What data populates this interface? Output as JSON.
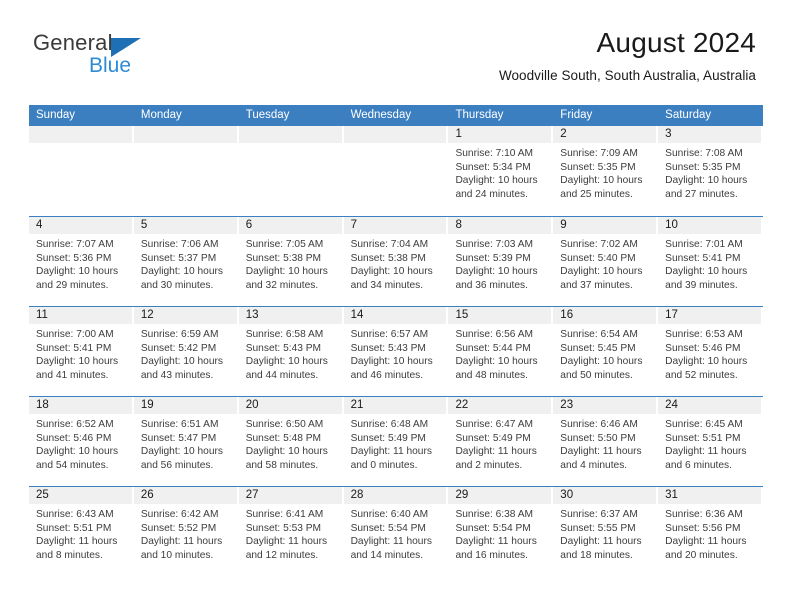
{
  "brand": {
    "name_part1": "General",
    "name_part2": "Blue",
    "logo_icon": "triangle-flag-icon",
    "color_primary": "#1f6fb5",
    "color_secondary": "#2e8bd6"
  },
  "header": {
    "title": "August 2024",
    "location": "Woodville South, South Australia, Australia"
  },
  "theme": {
    "header_row_bg": "#3c7fc1",
    "day_band_bg": "#f0f0f0",
    "divider": "#3c7fc1",
    "text": "#1a1a1a"
  },
  "weekdays": [
    "Sunday",
    "Monday",
    "Tuesday",
    "Wednesday",
    "Thursday",
    "Friday",
    "Saturday"
  ],
  "weeks": [
    [
      {
        "day": "",
        "blank": true
      },
      {
        "day": "",
        "blank": true
      },
      {
        "day": "",
        "blank": true
      },
      {
        "day": "",
        "blank": true
      },
      {
        "day": "1",
        "sunrise": "Sunrise: 7:10 AM",
        "sunset": "Sunset: 5:34 PM",
        "daylight1": "Daylight: 10 hours",
        "daylight2": "and 24 minutes."
      },
      {
        "day": "2",
        "sunrise": "Sunrise: 7:09 AM",
        "sunset": "Sunset: 5:35 PM",
        "daylight1": "Daylight: 10 hours",
        "daylight2": "and 25 minutes."
      },
      {
        "day": "3",
        "sunrise": "Sunrise: 7:08 AM",
        "sunset": "Sunset: 5:35 PM",
        "daylight1": "Daylight: 10 hours",
        "daylight2": "and 27 minutes."
      }
    ],
    [
      {
        "day": "4",
        "sunrise": "Sunrise: 7:07 AM",
        "sunset": "Sunset: 5:36 PM",
        "daylight1": "Daylight: 10 hours",
        "daylight2": "and 29 minutes."
      },
      {
        "day": "5",
        "sunrise": "Sunrise: 7:06 AM",
        "sunset": "Sunset: 5:37 PM",
        "daylight1": "Daylight: 10 hours",
        "daylight2": "and 30 minutes."
      },
      {
        "day": "6",
        "sunrise": "Sunrise: 7:05 AM",
        "sunset": "Sunset: 5:38 PM",
        "daylight1": "Daylight: 10 hours",
        "daylight2": "and 32 minutes."
      },
      {
        "day": "7",
        "sunrise": "Sunrise: 7:04 AM",
        "sunset": "Sunset: 5:38 PM",
        "daylight1": "Daylight: 10 hours",
        "daylight2": "and 34 minutes."
      },
      {
        "day": "8",
        "sunrise": "Sunrise: 7:03 AM",
        "sunset": "Sunset: 5:39 PM",
        "daylight1": "Daylight: 10 hours",
        "daylight2": "and 36 minutes."
      },
      {
        "day": "9",
        "sunrise": "Sunrise: 7:02 AM",
        "sunset": "Sunset: 5:40 PM",
        "daylight1": "Daylight: 10 hours",
        "daylight2": "and 37 minutes."
      },
      {
        "day": "10",
        "sunrise": "Sunrise: 7:01 AM",
        "sunset": "Sunset: 5:41 PM",
        "daylight1": "Daylight: 10 hours",
        "daylight2": "and 39 minutes."
      }
    ],
    [
      {
        "day": "11",
        "sunrise": "Sunrise: 7:00 AM",
        "sunset": "Sunset: 5:41 PM",
        "daylight1": "Daylight: 10 hours",
        "daylight2": "and 41 minutes."
      },
      {
        "day": "12",
        "sunrise": "Sunrise: 6:59 AM",
        "sunset": "Sunset: 5:42 PM",
        "daylight1": "Daylight: 10 hours",
        "daylight2": "and 43 minutes."
      },
      {
        "day": "13",
        "sunrise": "Sunrise: 6:58 AM",
        "sunset": "Sunset: 5:43 PM",
        "daylight1": "Daylight: 10 hours",
        "daylight2": "and 44 minutes."
      },
      {
        "day": "14",
        "sunrise": "Sunrise: 6:57 AM",
        "sunset": "Sunset: 5:43 PM",
        "daylight1": "Daylight: 10 hours",
        "daylight2": "and 46 minutes."
      },
      {
        "day": "15",
        "sunrise": "Sunrise: 6:56 AM",
        "sunset": "Sunset: 5:44 PM",
        "daylight1": "Daylight: 10 hours",
        "daylight2": "and 48 minutes."
      },
      {
        "day": "16",
        "sunrise": "Sunrise: 6:54 AM",
        "sunset": "Sunset: 5:45 PM",
        "daylight1": "Daylight: 10 hours",
        "daylight2": "and 50 minutes."
      },
      {
        "day": "17",
        "sunrise": "Sunrise: 6:53 AM",
        "sunset": "Sunset: 5:46 PM",
        "daylight1": "Daylight: 10 hours",
        "daylight2": "and 52 minutes."
      }
    ],
    [
      {
        "day": "18",
        "sunrise": "Sunrise: 6:52 AM",
        "sunset": "Sunset: 5:46 PM",
        "daylight1": "Daylight: 10 hours",
        "daylight2": "and 54 minutes."
      },
      {
        "day": "19",
        "sunrise": "Sunrise: 6:51 AM",
        "sunset": "Sunset: 5:47 PM",
        "daylight1": "Daylight: 10 hours",
        "daylight2": "and 56 minutes."
      },
      {
        "day": "20",
        "sunrise": "Sunrise: 6:50 AM",
        "sunset": "Sunset: 5:48 PM",
        "daylight1": "Daylight: 10 hours",
        "daylight2": "and 58 minutes."
      },
      {
        "day": "21",
        "sunrise": "Sunrise: 6:48 AM",
        "sunset": "Sunset: 5:49 PM",
        "daylight1": "Daylight: 11 hours",
        "daylight2": "and 0 minutes."
      },
      {
        "day": "22",
        "sunrise": "Sunrise: 6:47 AM",
        "sunset": "Sunset: 5:49 PM",
        "daylight1": "Daylight: 11 hours",
        "daylight2": "and 2 minutes."
      },
      {
        "day": "23",
        "sunrise": "Sunrise: 6:46 AM",
        "sunset": "Sunset: 5:50 PM",
        "daylight1": "Daylight: 11 hours",
        "daylight2": "and 4 minutes."
      },
      {
        "day": "24",
        "sunrise": "Sunrise: 6:45 AM",
        "sunset": "Sunset: 5:51 PM",
        "daylight1": "Daylight: 11 hours",
        "daylight2": "and 6 minutes."
      }
    ],
    [
      {
        "day": "25",
        "sunrise": "Sunrise: 6:43 AM",
        "sunset": "Sunset: 5:51 PM",
        "daylight1": "Daylight: 11 hours",
        "daylight2": "and 8 minutes."
      },
      {
        "day": "26",
        "sunrise": "Sunrise: 6:42 AM",
        "sunset": "Sunset: 5:52 PM",
        "daylight1": "Daylight: 11 hours",
        "daylight2": "and 10 minutes."
      },
      {
        "day": "27",
        "sunrise": "Sunrise: 6:41 AM",
        "sunset": "Sunset: 5:53 PM",
        "daylight1": "Daylight: 11 hours",
        "daylight2": "and 12 minutes."
      },
      {
        "day": "28",
        "sunrise": "Sunrise: 6:40 AM",
        "sunset": "Sunset: 5:54 PM",
        "daylight1": "Daylight: 11 hours",
        "daylight2": "and 14 minutes."
      },
      {
        "day": "29",
        "sunrise": "Sunrise: 6:38 AM",
        "sunset": "Sunset: 5:54 PM",
        "daylight1": "Daylight: 11 hours",
        "daylight2": "and 16 minutes."
      },
      {
        "day": "30",
        "sunrise": "Sunrise: 6:37 AM",
        "sunset": "Sunset: 5:55 PM",
        "daylight1": "Daylight: 11 hours",
        "daylight2": "and 18 minutes."
      },
      {
        "day": "31",
        "sunrise": "Sunrise: 6:36 AM",
        "sunset": "Sunset: 5:56 PM",
        "daylight1": "Daylight: 11 hours",
        "daylight2": "and 20 minutes."
      }
    ]
  ]
}
